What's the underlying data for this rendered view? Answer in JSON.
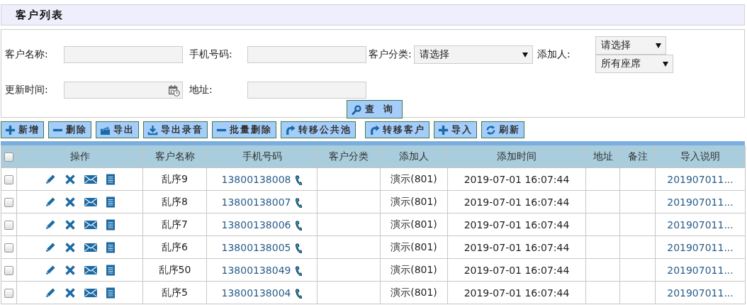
{
  "title": "客户列表",
  "filters": [
    {
      "kind": "text",
      "label": "客户名称:"
    },
    {
      "kind": "text",
      "label": "手机号码:"
    },
    {
      "kind": "select",
      "label": "客户分类:",
      "values": [
        "请选择"
      ]
    },
    {
      "kind": "select",
      "label": "添加人:",
      "values": [
        "请选择",
        "所有座席"
      ]
    },
    {
      "kind": "date",
      "label": "更新时间:"
    },
    {
      "kind": "text",
      "label": "地址:"
    }
  ],
  "search_button": "查　询",
  "toolbar": [
    {
      "kind": "add",
      "label": "新增"
    },
    {
      "kind": "remove",
      "label": "删除"
    },
    {
      "kind": "export",
      "label": "导出"
    },
    {
      "kind": "download",
      "label": "导出录音"
    },
    {
      "kind": "remove",
      "label": "批量删除"
    },
    {
      "kind": "transfer",
      "label": "转移公共池"
    },
    {
      "kind": "transfer",
      "label": "转移客户"
    },
    {
      "kind": "add",
      "label": "导入"
    },
    {
      "kind": "refresh",
      "label": "刷新"
    }
  ],
  "table": {
    "select_all_checked": false,
    "columns": [
      "操作",
      "客户名称",
      "手机号码",
      "客户分类",
      "添加人",
      "添加时间",
      "地址",
      "备注",
      "导入说明"
    ],
    "rows": [
      {
        "checked": false,
        "name": "乱序9",
        "phone": "13800138008",
        "adder": "演示(801)",
        "time": "2019-07-01 16:07:44",
        "import_note": "201907011..."
      },
      {
        "checked": false,
        "name": "乱序8",
        "phone": "13800138007",
        "adder": "演示(801)",
        "time": "2019-07-01 16:07:44",
        "import_note": "201907011..."
      },
      {
        "checked": false,
        "name": "乱序7",
        "phone": "13800138006",
        "adder": "演示(801)",
        "time": "2019-07-01 16:07:44",
        "import_note": "201907011..."
      },
      {
        "checked": false,
        "name": "乱序6",
        "phone": "13800138005",
        "adder": "演示(801)",
        "time": "2019-07-01 16:07:44",
        "import_note": "201907011..."
      },
      {
        "checked": false,
        "name": "乱序50",
        "phone": "13800138049",
        "adder": "演示(801)",
        "time": "2019-07-01 16:07:44",
        "import_note": "201907011..."
      },
      {
        "checked": false,
        "name": "乱序5",
        "phone": "13800138004",
        "adder": "演示(801)",
        "time": "2019-07-01 16:07:44",
        "import_note": "201907011..."
      }
    ]
  }
}
